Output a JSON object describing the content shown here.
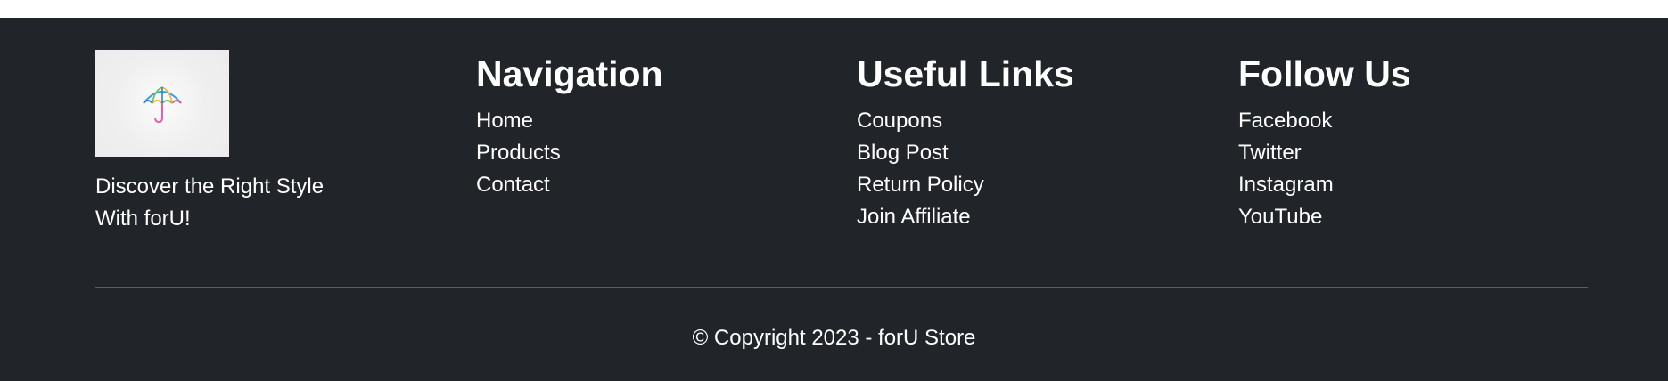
{
  "brand": {
    "logo_icon": "umbrella-icon",
    "tagline": "Discover the Right Style With forU!"
  },
  "navigation": {
    "title": "Navigation",
    "items": [
      "Home",
      "Products",
      "Contact"
    ]
  },
  "useful_links": {
    "title": "Useful Links",
    "items": [
      "Coupons",
      "Blog Post",
      "Return Policy",
      "Join Affiliate"
    ]
  },
  "follow_us": {
    "title": "Follow Us",
    "items": [
      "Facebook",
      "Twitter",
      "Instagram",
      "YouTube"
    ]
  },
  "copyright": "© Copyright 2023 - forU Store",
  "colors": {
    "footer_bg": "#212529",
    "text": "#ffffff",
    "divider": "#5a5f65"
  }
}
